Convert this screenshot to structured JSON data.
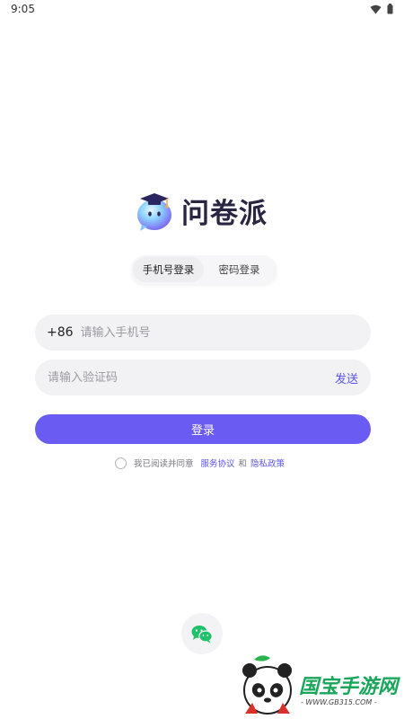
{
  "status_bar": {
    "time": "9:05"
  },
  "app": {
    "name": "问卷派"
  },
  "tabs": [
    {
      "label": "手机号登录",
      "active": true
    },
    {
      "label": "密码登录",
      "active": false
    }
  ],
  "phone": {
    "country_code": "+86",
    "placeholder": "请输入手机号",
    "value": ""
  },
  "code": {
    "placeholder": "请输入验证码",
    "value": "",
    "send_label": "发送"
  },
  "login_button": {
    "label": "登录"
  },
  "agreement": {
    "prefix": "我已阅读并同意",
    "service_link": "服务协议",
    "and": "和",
    "privacy_link": "隐私政策"
  },
  "wechat": {
    "icon": "wechat-icon"
  },
  "watermark": {
    "brand": "国宝手游网",
    "url": "- WWW.GB315.COM -"
  },
  "colors": {
    "accent": "#6a5cf2",
    "link": "#5b55e6",
    "field_bg": "#f2f2f4",
    "wechat_green": "#1fc16b"
  }
}
